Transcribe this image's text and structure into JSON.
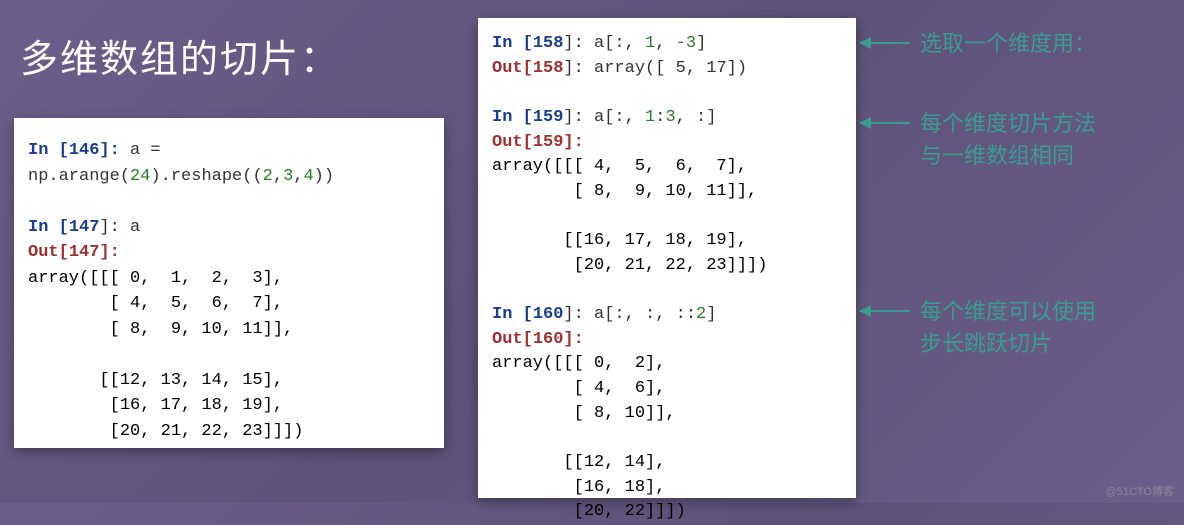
{
  "title": "多维数组的切片：",
  "left": {
    "in146_prompt": "In [",
    "in146_num": "146",
    "in146_suffix": "]: ",
    "in146_code": "a = np.arange(",
    "in146_arg1": "24",
    "in146_mid": ").reshape((",
    "in146_arg2": "2",
    "in146_c1": ",",
    "in146_arg3": "3",
    "in146_c2": ",",
    "in146_arg4": "4",
    "in146_end": "))",
    "in147_prompt": "In [",
    "in147_num": "147",
    "in147_suffix": "]: a",
    "out147_prompt": "Out[",
    "out147_num": "147",
    "out147_suffix": "]:",
    "out147_body": "array([[[ 0,  1,  2,  3],\n        [ 4,  5,  6,  7],\n        [ 8,  9, 10, 11]],\n\n       [[12, 13, 14, 15],\n        [16, 17, 18, 19],\n        [20, 21, 22, 23]]])"
  },
  "right": {
    "in158_prompt": "In [",
    "in158_num": "158",
    "in158_suffix": "]: a[:, ",
    "in158_a1": "1",
    "in158_m": ", ",
    "in158_a2": "-3",
    "in158_end": "]",
    "out158_prompt": "Out[",
    "out158_num": "158",
    "out158_suffix": "]: array([ 5, 17])",
    "in159_prompt": "In [",
    "in159_num": "159",
    "in159_suffix": "]: a[:, ",
    "in159_a1": "1",
    "in159_c": ":",
    "in159_a2": "3",
    "in159_end": ", :]",
    "out159_prompt": "Out[",
    "out159_num": "159",
    "out159_suffix": "]:",
    "out159_body": "array([[[ 4,  5,  6,  7],\n        [ 8,  9, 10, 11]],\n\n       [[16, 17, 18, 19],\n        [20, 21, 22, 23]]])",
    "in160_prompt": "In [",
    "in160_num": "160",
    "in160_suffix": "]: a[:, :, ::",
    "in160_a1": "2",
    "in160_end": "]",
    "out160_prompt": "Out[",
    "out160_num": "160",
    "out160_suffix": "]:",
    "out160_body": "array([[[ 0,  2],\n        [ 4,  6],\n        [ 8, 10]],\n\n       [[12, 14],\n        [16, 18],\n        [20, 22]]])"
  },
  "annotations": {
    "a1": "选取一个维度用：",
    "a2_l1": "每个维度切片方法",
    "a2_l2": "与一维数组相同",
    "a3_l1": "每个维度可以使用",
    "a3_l2": "步长跳跃切片"
  },
  "watermark": "@51CTO博客"
}
